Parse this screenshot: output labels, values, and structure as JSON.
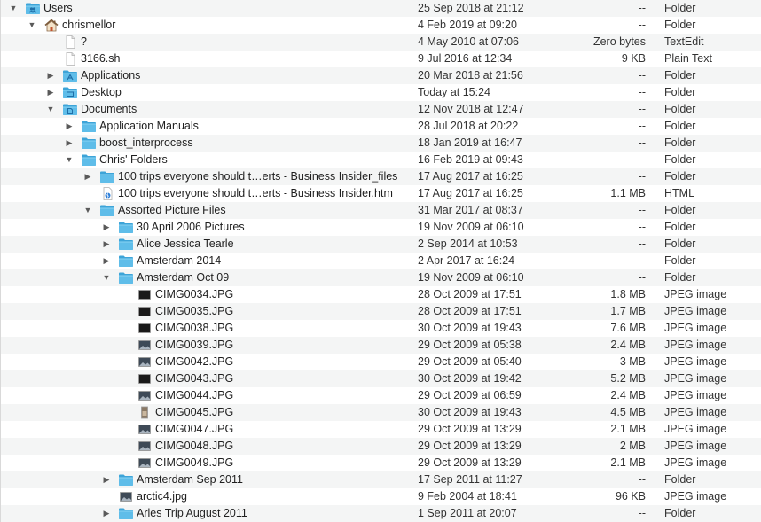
{
  "rows": [
    {
      "depth": 0,
      "disclosure": "open",
      "icon": "users-folder-icon",
      "name": "Users",
      "date": "25 Sep 2018 at 21:12",
      "size": "--",
      "kind": "Folder"
    },
    {
      "depth": 1,
      "disclosure": "open",
      "icon": "home-icon",
      "name": "chrismellor",
      "date": "4 Feb 2019 at 09:20",
      "size": "--",
      "kind": "Folder"
    },
    {
      "depth": 2,
      "disclosure": "none",
      "icon": "document-icon",
      "name": "?",
      "date": "4 May 2010 at 07:06",
      "size": "Zero bytes",
      "kind": "TextEdit"
    },
    {
      "depth": 2,
      "disclosure": "none",
      "icon": "document-icon",
      "name": "3166.sh",
      "date": "9 Jul 2016 at 12:34",
      "size": "9 KB",
      "kind": "Plain Text"
    },
    {
      "depth": 2,
      "disclosure": "closed",
      "icon": "applications-folder-icon",
      "name": "Applications",
      "date": "20 Mar 2018 at 21:56",
      "size": "--",
      "kind": "Folder"
    },
    {
      "depth": 2,
      "disclosure": "closed",
      "icon": "desktop-folder-icon",
      "name": "Desktop",
      "date": "Today at 15:24",
      "size": "--",
      "kind": "Folder"
    },
    {
      "depth": 2,
      "disclosure": "open",
      "icon": "documents-folder-icon",
      "name": "Documents",
      "date": "12 Nov 2018 at 12:47",
      "size": "--",
      "kind": "Folder"
    },
    {
      "depth": 3,
      "disclosure": "closed",
      "icon": "folder-icon",
      "name": "Application Manuals",
      "date": "28 Jul 2018 at 20:22",
      "size": "--",
      "kind": "Folder"
    },
    {
      "depth": 3,
      "disclosure": "closed",
      "icon": "folder-icon",
      "name": "boost_interprocess",
      "date": "18 Jan 2019 at 16:47",
      "size": "--",
      "kind": "Folder"
    },
    {
      "depth": 3,
      "disclosure": "open",
      "icon": "folder-icon",
      "name": "Chris' Folders",
      "date": "16 Feb 2019 at 09:43",
      "size": "--",
      "kind": "Folder"
    },
    {
      "depth": 4,
      "disclosure": "closed",
      "icon": "folder-icon",
      "name": "100 trips everyone should t…erts - Business Insider_files",
      "date": "17 Aug 2017 at 16:25",
      "size": "--",
      "kind": "Folder"
    },
    {
      "depth": 4,
      "disclosure": "none",
      "icon": "html-file-icon",
      "name": "100 trips everyone should t…erts - Business Insider.htm",
      "date": "17 Aug 2017 at 16:25",
      "size": "1.1 MB",
      "kind": "HTML"
    },
    {
      "depth": 4,
      "disclosure": "open",
      "icon": "folder-icon",
      "name": "Assorted Picture Files",
      "date": "31 Mar 2017 at 08:37",
      "size": "--",
      "kind": "Folder"
    },
    {
      "depth": 5,
      "disclosure": "closed",
      "icon": "folder-icon",
      "name": "30 April 2006 Pictures",
      "date": "19 Nov 2009 at 06:10",
      "size": "--",
      "kind": "Folder"
    },
    {
      "depth": 5,
      "disclosure": "closed",
      "icon": "folder-icon",
      "name": "Alice Jessica Tearle",
      "date": "2 Sep 2014 at 10:53",
      "size": "--",
      "kind": "Folder"
    },
    {
      "depth": 5,
      "disclosure": "closed",
      "icon": "folder-icon",
      "name": "Amsterdam 2014",
      "date": "2 Apr 2017 at 16:24",
      "size": "--",
      "kind": "Folder"
    },
    {
      "depth": 5,
      "disclosure": "open",
      "icon": "folder-icon",
      "name": "Amsterdam Oct 09",
      "date": "19 Nov 2009 at 06:10",
      "size": "--",
      "kind": "Folder"
    },
    {
      "depth": 6,
      "disclosure": "none",
      "icon": "image-thumbnail-dark-icon",
      "name": "CIMG0034.JPG",
      "date": "28 Oct 2009 at 17:51",
      "size": "1.8 MB",
      "kind": "JPEG image"
    },
    {
      "depth": 6,
      "disclosure": "none",
      "icon": "image-thumbnail-dark-icon",
      "name": "CIMG0035.JPG",
      "date": "28 Oct 2009 at 17:51",
      "size": "1.7 MB",
      "kind": "JPEG image"
    },
    {
      "depth": 6,
      "disclosure": "none",
      "icon": "image-thumbnail-dark-icon",
      "name": "CIMG0038.JPG",
      "date": "30 Oct 2009 at 19:43",
      "size": "7.6 MB",
      "kind": "JPEG image"
    },
    {
      "depth": 6,
      "disclosure": "none",
      "icon": "image-thumbnail-icon",
      "name": "CIMG0039.JPG",
      "date": "29 Oct 2009 at 05:38",
      "size": "2.4 MB",
      "kind": "JPEG image"
    },
    {
      "depth": 6,
      "disclosure": "none",
      "icon": "image-thumbnail-icon",
      "name": "CIMG0042.JPG",
      "date": "29 Oct 2009 at 05:40",
      "size": "3 MB",
      "kind": "JPEG image"
    },
    {
      "depth": 6,
      "disclosure": "none",
      "icon": "image-thumbnail-dark-icon",
      "name": "CIMG0043.JPG",
      "date": "30 Oct 2009 at 19:42",
      "size": "5.2 MB",
      "kind": "JPEG image"
    },
    {
      "depth": 6,
      "disclosure": "none",
      "icon": "image-thumbnail-icon",
      "name": "CIMG0044.JPG",
      "date": "29 Oct 2009 at 06:59",
      "size": "2.4 MB",
      "kind": "JPEG image"
    },
    {
      "depth": 6,
      "disclosure": "none",
      "icon": "image-thumbnail-portrait-icon",
      "name": "CIMG0045.JPG",
      "date": "30 Oct 2009 at 19:43",
      "size": "4.5 MB",
      "kind": "JPEG image"
    },
    {
      "depth": 6,
      "disclosure": "none",
      "icon": "image-thumbnail-icon",
      "name": "CIMG0047.JPG",
      "date": "29 Oct 2009 at 13:29",
      "size": "2.1 MB",
      "kind": "JPEG image"
    },
    {
      "depth": 6,
      "disclosure": "none",
      "icon": "image-thumbnail-icon",
      "name": "CIMG0048.JPG",
      "date": "29 Oct 2009 at 13:29",
      "size": "2 MB",
      "kind": "JPEG image"
    },
    {
      "depth": 6,
      "disclosure": "none",
      "icon": "image-thumbnail-icon",
      "name": "CIMG0049.JPG",
      "date": "29 Oct 2009 at 13:29",
      "size": "2.1 MB",
      "kind": "JPEG image"
    },
    {
      "depth": 5,
      "disclosure": "closed",
      "icon": "folder-icon",
      "name": "Amsterdam Sep 2011",
      "date": "17 Sep 2011 at 11:27",
      "size": "--",
      "kind": "Folder"
    },
    {
      "depth": 5,
      "disclosure": "none",
      "icon": "image-thumbnail-icon",
      "name": "arctic4.jpg",
      "date": "9 Feb 2004 at 18:41",
      "size": "96 KB",
      "kind": "JPEG image"
    },
    {
      "depth": 5,
      "disclosure": "closed",
      "icon": "folder-icon",
      "name": "Arles Trip August 2011",
      "date": "1 Sep 2011 at 20:07",
      "size": "--",
      "kind": "Folder"
    }
  ],
  "glyphs": {
    "open": "▼",
    "closed": "▶"
  },
  "colors": {
    "folder": "#5fbde9",
    "folder_tab": "#8ad3f3",
    "folder_dark": "#3da4d8",
    "stripe": "#f4f5f5"
  }
}
